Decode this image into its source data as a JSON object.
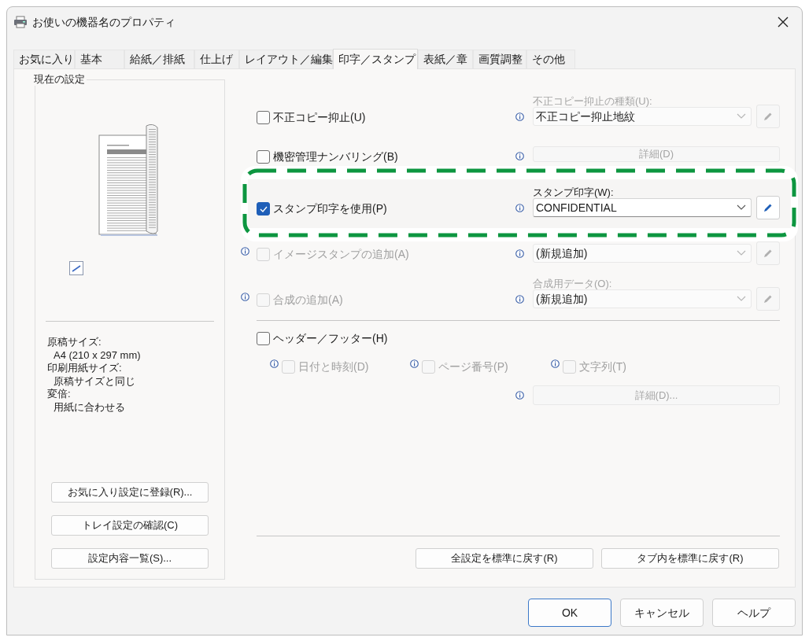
{
  "window": {
    "title": "お使いの機器名のプロパティ"
  },
  "tabs": [
    {
      "label": "お気に入り",
      "selected": false
    },
    {
      "label": "基本",
      "selected": false
    },
    {
      "label": "給紙／排紙",
      "selected": false
    },
    {
      "label": "仕上げ",
      "selected": false
    },
    {
      "label": "レイアウト／編集",
      "selected": false
    },
    {
      "label": "印字／スタンプ",
      "selected": true
    },
    {
      "label": "表紙／章",
      "selected": false
    },
    {
      "label": "画質調整",
      "selected": false
    },
    {
      "label": "その他",
      "selected": false
    }
  ],
  "current_settings": {
    "title": "現在の設定",
    "details": [
      {
        "label": "原稿サイズ:",
        "value": "A4 (210 x 297 mm)"
      },
      {
        "label": "印刷用紙サイズ:",
        "value": "原稿サイズと同じ"
      },
      {
        "label": "変倍:",
        "value": "用紙に合わせる"
      }
    ],
    "buttons": [
      "お気に入り設定に登録(R)...",
      "トレイ設定の確認(C)",
      "設定内容一覧(S)..."
    ]
  },
  "options": [
    {
      "check": {
        "label": "不正コピー抑止(U)",
        "checked": false,
        "disabled": false
      },
      "left_info": false,
      "highlighted": false,
      "field": {
        "kind": "combo",
        "label": "不正コピー抑止の種類(U):",
        "value": "不正コピー抑止地紋",
        "disabled": true
      }
    },
    {
      "check": {
        "label": "機密管理ナンバリング(B)",
        "checked": false,
        "disabled": false
      },
      "left_info": false,
      "highlighted": false,
      "field": {
        "kind": "button",
        "value": "詳細(D)",
        "disabled": true
      }
    },
    {
      "check": {
        "label": "スタンプ印字を使用(P)",
        "checked": true,
        "disabled": false
      },
      "left_info": false,
      "highlighted": true,
      "field": {
        "kind": "combo",
        "label": "スタンプ印字(W):",
        "value": "CONFIDENTIAL",
        "disabled": false
      }
    },
    {
      "check": {
        "label": "イメージスタンプの追加(A)",
        "checked": false,
        "disabled": true
      },
      "left_info": true,
      "highlighted": false,
      "field": {
        "kind": "combo",
        "value": "(新規追加)",
        "disabled": true
      }
    },
    {
      "check": {
        "label": "合成の追加(A)",
        "checked": false,
        "disabled": true
      },
      "left_info": true,
      "highlighted": false,
      "field": {
        "kind": "combo",
        "label": "合成用データ(O):",
        "value": "(新規追加)",
        "disabled": true
      }
    }
  ],
  "header_footer": {
    "check": {
      "label": "ヘッダー／フッター(H)",
      "checked": false,
      "disabled": false
    },
    "items": [
      {
        "label": "日付と時刻(D)",
        "checked": false,
        "disabled": true
      },
      {
        "label": "ページ番号(P)",
        "checked": false,
        "disabled": true
      },
      {
        "label": "文字列(T)",
        "checked": false,
        "disabled": true
      }
    ],
    "details_button": {
      "label": "詳細(D)...",
      "disabled": true
    }
  },
  "reset_buttons": [
    "全設定を標準に戻す(R)",
    "タブ内を標準に戻す(R)"
  ],
  "dialog_buttons": [
    {
      "label": "OK",
      "default": true
    },
    {
      "label": "キャンセル",
      "default": false
    },
    {
      "label": "ヘルプ",
      "default": false
    }
  ]
}
